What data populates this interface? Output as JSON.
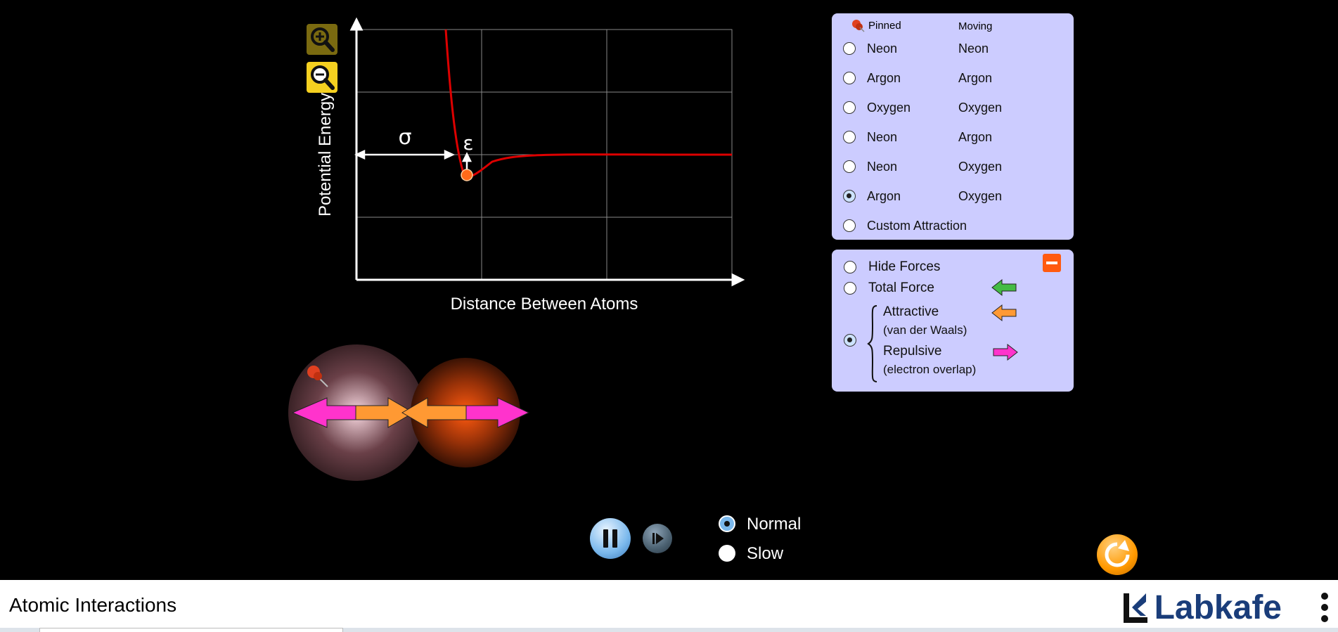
{
  "app": {
    "title": "Atomic Interactions",
    "brand": "Labkafe"
  },
  "graph": {
    "ylabel": "Potential Energy",
    "xlabel": "Distance Between Atoms",
    "sigma": "σ",
    "epsilon": "ε"
  },
  "atoms": {
    "header_pinned": "Pinned",
    "header_moving": "Moving",
    "options": [
      {
        "pinned": "Neon",
        "moving": "Neon",
        "selected": false
      },
      {
        "pinned": "Argon",
        "moving": "Argon",
        "selected": false
      },
      {
        "pinned": "Oxygen",
        "moving": "Oxygen",
        "selected": false
      },
      {
        "pinned": "Neon",
        "moving": "Argon",
        "selected": false
      },
      {
        "pinned": "Neon",
        "moving": "Oxygen",
        "selected": false
      },
      {
        "pinned": "Argon",
        "moving": "Oxygen",
        "selected": true
      }
    ],
    "custom": "Custom Attraction"
  },
  "forces": {
    "hide": "Hide Forces",
    "total": "Total Force",
    "attractive": "Attractive",
    "attractive_sub": "(van der Waals)",
    "repulsive": "Repulsive",
    "repulsive_sub": "(electron overlap)",
    "selected": "components"
  },
  "speed": {
    "normal": "Normal",
    "slow": "Slow",
    "selected": "normal"
  },
  "colors": {
    "panel": "#ccccff",
    "curve": "#dd0000",
    "total": "#44bb44",
    "attractive": "#ff9933",
    "repulsive": "#ff33cc",
    "reset": "#ff9900"
  }
}
